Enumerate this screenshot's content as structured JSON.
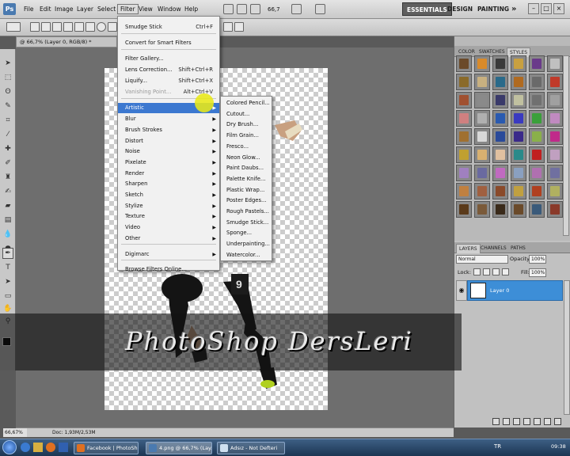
{
  "menubar": {
    "logo": "Ps",
    "items": [
      "File",
      "Edit",
      "Image",
      "Layer",
      "Select",
      "Filter",
      "View",
      "Window",
      "Help"
    ],
    "active": "Filter",
    "zoom": "66,7",
    "workspaces": [
      "ESSENTIALS",
      "DESIGN",
      "PAINTING"
    ],
    "more": "»"
  },
  "document": {
    "tab": "@ 66,7% (Layer 0, RGB/8) *",
    "zoom": "66,67%",
    "doc_size": "Doc: 1,93M/2,53M"
  },
  "filter_menu": {
    "items": [
      {
        "label": "Smudge Stick",
        "shortcut": "Ctrl+F"
      },
      {
        "label": "Convert for Smart Filters"
      },
      {
        "label": "Filter Gallery..."
      },
      {
        "label": "Lens Correction...",
        "shortcut": "Shift+Ctrl+R"
      },
      {
        "label": "Liquify...",
        "shortcut": "Shift+Ctrl+X"
      },
      {
        "label": "Vanishing Point...",
        "shortcut": "Alt+Ctrl+V"
      },
      {
        "label": "Artistic"
      },
      {
        "label": "Blur"
      },
      {
        "label": "Brush Strokes"
      },
      {
        "label": "Distort"
      },
      {
        "label": "Noise"
      },
      {
        "label": "Pixelate"
      },
      {
        "label": "Render"
      },
      {
        "label": "Sharpen"
      },
      {
        "label": "Sketch"
      },
      {
        "label": "Stylize"
      },
      {
        "label": "Texture"
      },
      {
        "label": "Video"
      },
      {
        "label": "Other"
      },
      {
        "label": "Digimarc"
      },
      {
        "label": "Browse Filters Online..."
      }
    ]
  },
  "artistic_submenu": [
    "Colored Pencil...",
    "Cutout...",
    "Dry Brush...",
    "Film Grain...",
    "Fresco...",
    "Neon Glow...",
    "Paint Daubs...",
    "Palette Knife...",
    "Plastic Wrap...",
    "Poster Edges...",
    "Rough Pastels...",
    "Smudge Stick...",
    "Sponge...",
    "Underpainting...",
    "Watercolor..."
  ],
  "panels": {
    "styles_tabs": [
      "COLOR",
      "SWATCHES",
      "STYLES"
    ],
    "layers_tabs": [
      "LAYERS",
      "CHANNELS",
      "PATHS"
    ],
    "blend_mode": "Normal",
    "opacity_label": "Opacity:",
    "opacity": "100%",
    "lock_label": "Lock:",
    "fill_label": "Fill:",
    "fill": "100%",
    "layer_name": "Layer 0",
    "style_colors": [
      "#6b4a2a",
      "#d88a2a",
      "#3a3a3a",
      "#c8a040",
      "#6a3a8a",
      "#c0c0c0",
      "#8a6a2a",
      "#c8b080",
      "#2a6a8a",
      "#b06a20",
      "#6a6a6a",
      "#c03a2a",
      "#a05030",
      "#8a8a8a",
      "#3a3a6a",
      "#c0c0a0",
      "#707070",
      "#a0a0a0",
      "#d08080",
      "#b0b0b0",
      "#2a5ab0",
      "#3a3ac0",
      "#3aa03a",
      "#c08ac0",
      "#a07030",
      "#d8d8d8",
      "#2a4a9a",
      "#3a2a8a",
      "#8ab04a",
      "#c02a8a",
      "#c0a030",
      "#d8b070",
      "#e0c0a0",
      "#2a8a8a",
      "#c02020",
      "#c0a0c0",
      "#a080c0",
      "#6a6aa0",
      "#c06ac0",
      "#8aa0c0",
      "#b070b0",
      "#7070a0",
      "#c08040",
      "#a06040",
      "#8a4a2a",
      "#c0a040",
      "#b04020",
      "#b0b060",
      "#5a3a1a",
      "#7a5a3a",
      "#3a2a1a",
      "#6a4a2a",
      "#3a5a7a",
      "#8a3a2a"
    ]
  },
  "taskbar": {
    "tasks": [
      "Facebook | PhotoSh...",
      "4.png @ 66,7% (Lay...",
      "Adsız - Not Defteri"
    ],
    "lang": "TR",
    "time": "09:38"
  },
  "watermark": "PhotoShop DersLeri",
  "player": {
    "number": "9"
  }
}
